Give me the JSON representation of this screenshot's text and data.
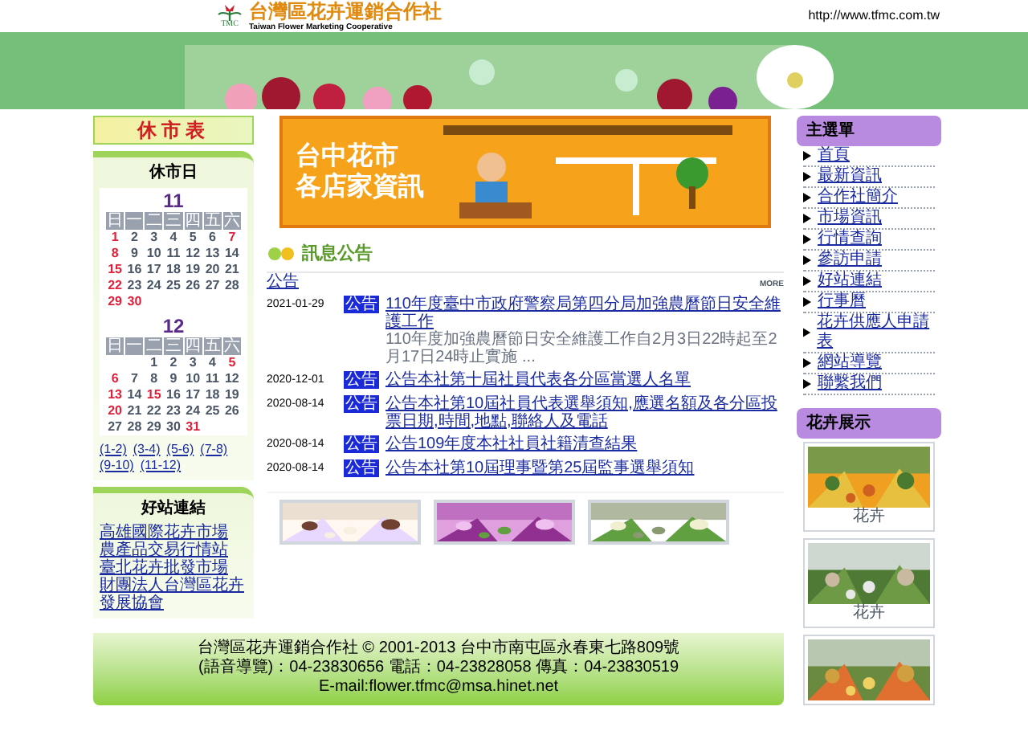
{
  "header": {
    "logo_text": "TMC",
    "title": "台灣區花卉運銷合作社",
    "subtitle": "Taiwan Flower Marketing Cooperative",
    "url": "http://www.tfmc.com.tw"
  },
  "left": {
    "closure_banner": "休市表",
    "calendar": {
      "title": "休市日",
      "months": [
        {
          "month": "11",
          "weekdays": [
            "日",
            "一",
            "二",
            "三",
            "四",
            "五",
            "六"
          ],
          "weeks": [
            [
              {
                "d": "1",
                "holiday": true
              },
              {
                "d": "2",
                "holiday": false
              },
              {
                "d": "3",
                "holiday": false
              },
              {
                "d": "4",
                "holiday": false
              },
              {
                "d": "5",
                "holiday": false
              },
              {
                "d": "6",
                "holiday": false
              },
              {
                "d": "7",
                "holiday": true
              }
            ],
            [
              {
                "d": "8",
                "holiday": true
              },
              {
                "d": "9",
                "holiday": false
              },
              {
                "d": "10",
                "holiday": false
              },
              {
                "d": "11",
                "holiday": false
              },
              {
                "d": "12",
                "holiday": false
              },
              {
                "d": "13",
                "holiday": false
              },
              {
                "d": "14",
                "holiday": false
              }
            ],
            [
              {
                "d": "15",
                "holiday": true
              },
              {
                "d": "16",
                "holiday": false
              },
              {
                "d": "17",
                "holiday": false
              },
              {
                "d": "18",
                "holiday": false
              },
              {
                "d": "19",
                "holiday": false
              },
              {
                "d": "20",
                "holiday": false
              },
              {
                "d": "21",
                "holiday": false
              }
            ],
            [
              {
                "d": "22",
                "holiday": true
              },
              {
                "d": "23",
                "holiday": false
              },
              {
                "d": "24",
                "holiday": false
              },
              {
                "d": "25",
                "holiday": false
              },
              {
                "d": "26",
                "holiday": false
              },
              {
                "d": "27",
                "holiday": false
              },
              {
                "d": "28",
                "holiday": false
              }
            ],
            [
              {
                "d": "29",
                "holiday": true
              },
              {
                "d": "30",
                "holiday": true
              }
            ]
          ]
        },
        {
          "month": "12",
          "weekdays": [
            "日",
            "一",
            "二",
            "三",
            "四",
            "五",
            "六"
          ],
          "weeks": [
            [
              {
                "d": "1",
                "holiday": false
              },
              {
                "d": "2",
                "holiday": false
              },
              {
                "d": "3",
                "holiday": false
              },
              {
                "d": "4",
                "holiday": false
              },
              {
                "d": "5",
                "holiday": true
              }
            ],
            [
              {
                "d": "6",
                "holiday": true
              },
              {
                "d": "7",
                "holiday": false
              },
              {
                "d": "8",
                "holiday": false
              },
              {
                "d": "9",
                "holiday": false
              },
              {
                "d": "10",
                "holiday": false
              },
              {
                "d": "11",
                "holiday": false
              },
              {
                "d": "12",
                "holiday": false
              }
            ],
            [
              {
                "d": "13",
                "holiday": true
              },
              {
                "d": "14",
                "holiday": false
              },
              {
                "d": "15",
                "holiday": true
              },
              {
                "d": "16",
                "holiday": false
              },
              {
                "d": "17",
                "holiday": false
              },
              {
                "d": "18",
                "holiday": false
              },
              {
                "d": "19",
                "holiday": false
              }
            ],
            [
              {
                "d": "20",
                "holiday": true
              },
              {
                "d": "21",
                "holiday": false
              },
              {
                "d": "22",
                "holiday": false
              },
              {
                "d": "23",
                "holiday": false
              },
              {
                "d": "24",
                "holiday": false
              },
              {
                "d": "25",
                "holiday": false
              },
              {
                "d": "26",
                "holiday": false
              }
            ],
            [
              {
                "d": "27",
                "holiday": false
              },
              {
                "d": "28",
                "holiday": false
              },
              {
                "d": "29",
                "holiday": false
              },
              {
                "d": "30",
                "holiday": false
              },
              {
                "d": "31",
                "holiday": true
              }
            ]
          ]
        }
      ],
      "links": [
        "(1-2)",
        "(3-4)",
        "(5-6)",
        "(7-8)",
        "(9-10)",
        "(11-12)"
      ]
    },
    "links_card": {
      "title": "好站連結",
      "links": [
        "高雄國際花卉市場",
        "農產品交易行情站",
        "臺北花卉批發市場",
        "財團法人台灣區花卉發展協會"
      ]
    }
  },
  "center": {
    "banner": {
      "title_lines": [
        "台中花市",
        "各店家資訊"
      ]
    },
    "news": {
      "title": "訊息公告",
      "category": "公告",
      "more": "MORE",
      "items": [
        {
          "date": "2021-01-29",
          "tag": "公告",
          "title": "110年度臺中市政府警察局第四分局加強農曆節日安全維護工作",
          "summary": "110年度加強農曆節日安全維護工作自2月3日22時起至2月17日24時止實施 ..."
        },
        {
          "date": "2020-12-01",
          "tag": "公告",
          "title": "公告本社第十屆社員代表各分區當選人名單"
        },
        {
          "date": "2020-08-14",
          "tag": "公告",
          "title": "公告本社第10屆社員代表選舉須知,應選名額及各分區投票日期,時間,地點,聯絡人及電話"
        },
        {
          "date": "2020-08-14",
          "tag": "公告",
          "title": "公告109年度本社社員社籍清查結果"
        },
        {
          "date": "2020-08-14",
          "tag": "公告",
          "title": "公告本社第10屆理事暨第25屆監事選舉須知"
        }
      ]
    },
    "promos": [
      {
        "kind": "picture"
      },
      {
        "kind": "picture"
      },
      {
        "kind": "picture"
      }
    ]
  },
  "right": {
    "menu": {
      "title": "主選單",
      "items": [
        "首頁",
        "最新資訊",
        "合作社簡介",
        "市場資訊",
        "行情查詢",
        "參訪申請",
        "好站連結",
        "行事曆",
        "花卉供應人申請表",
        "網站導覽",
        "聯繫我們"
      ]
    },
    "gallery": {
      "title": "花卉展示",
      "items": [
        {
          "kind": "picture",
          "caption": "花卉"
        },
        {
          "kind": "picture",
          "caption": "花卉"
        },
        {
          "kind": "picture"
        }
      ]
    }
  },
  "footer": {
    "lines": [
      "台灣區花卉運銷合作社 © 2001-2013 台中市南屯區永春東七路809號",
      "(語音導覽)：04-23830656 電話：04-23828058 傳真：04-23830519",
      "E-mail:flower.tfmc@msa.hinet.net"
    ]
  }
}
